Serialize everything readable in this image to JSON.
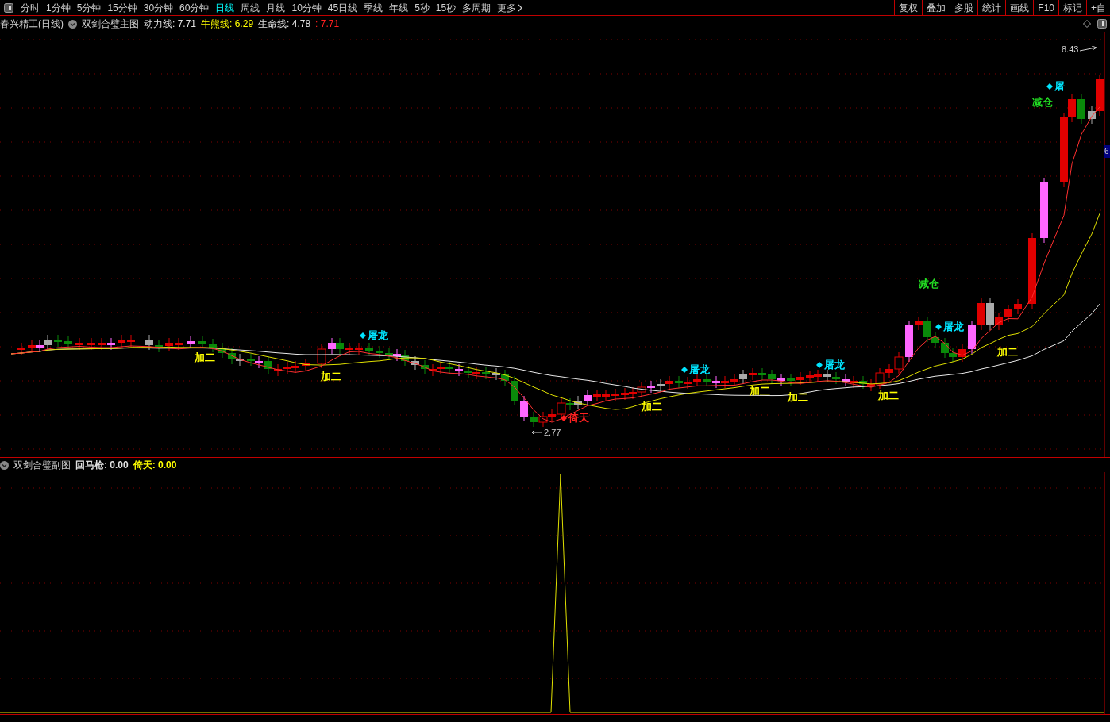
{
  "toolbar": {
    "tabs": [
      {
        "label": "分时",
        "selected": false
      },
      {
        "label": "1分钟",
        "selected": false
      },
      {
        "label": "5分钟",
        "selected": false
      },
      {
        "label": "15分钟",
        "selected": false
      },
      {
        "label": "30分钟",
        "selected": false
      },
      {
        "label": "60分钟",
        "selected": false
      },
      {
        "label": "日线",
        "selected": true
      },
      {
        "label": "周线",
        "selected": false
      },
      {
        "label": "月线",
        "selected": false
      },
      {
        "label": "10分钟",
        "selected": false
      },
      {
        "label": "45日线",
        "selected": false
      },
      {
        "label": "季线",
        "selected": false
      },
      {
        "label": "年线",
        "selected": false
      },
      {
        "label": "5秒",
        "selected": false
      },
      {
        "label": "15秒",
        "selected": false
      },
      {
        "label": "多周期",
        "selected": false
      }
    ],
    "more": "更多",
    "actions": [
      "复权",
      "叠加",
      "多股",
      "统计",
      "画线",
      "F10",
      "标记",
      "+自"
    ]
  },
  "main_legend": {
    "stock": "春兴精工(日线)",
    "indicator": "双剑合璧主图",
    "values": [
      {
        "text": "动力线: 7.71",
        "color": "#e0e0e0"
      },
      {
        "text": "牛熊线: 6.29",
        "color": "#ffff00"
      },
      {
        "text": "生命线: 4.78",
        "color": "#e0e0e0"
      },
      {
        "text": ": 7.71",
        "color": "#ff2020"
      }
    ]
  },
  "chart_labels": [
    {
      "kind": "plain",
      "text": "加二",
      "color": "#ffff00"
    },
    {
      "kind": "plain",
      "text": "加二",
      "color": "#ffff00"
    },
    {
      "kind": "signal",
      "text": "屠龙",
      "color": "#00e5ff"
    },
    {
      "kind": "signal",
      "text": "倚天",
      "color": "#ff2020"
    },
    {
      "kind": "plain",
      "text": "加二",
      "color": "#ffff00"
    },
    {
      "kind": "signal",
      "text": "屠龙",
      "color": "#00e5ff"
    },
    {
      "kind": "plain",
      "text": "加二",
      "color": "#ffff00"
    },
    {
      "kind": "plain",
      "text": "加二",
      "color": "#ffff00"
    },
    {
      "kind": "signal",
      "text": "屠龙",
      "color": "#00e5ff"
    },
    {
      "kind": "plain",
      "text": "加二",
      "color": "#ffff00"
    },
    {
      "kind": "plain",
      "text": "减仓",
      "color": "#22dd22"
    },
    {
      "kind": "signal",
      "text": "屠龙",
      "color": "#00e5ff"
    },
    {
      "kind": "plain",
      "text": "加二",
      "color": "#ffff00"
    },
    {
      "kind": "signal",
      "text": "屠",
      "color": "#00e5ff"
    },
    {
      "kind": "plain",
      "text": "减仓",
      "color": "#22dd22"
    }
  ],
  "price_marks": [
    {
      "kind": "high",
      "text": "8.43"
    },
    {
      "kind": "low",
      "text": "2.77"
    }
  ],
  "axis_label": "6",
  "sub_legend": {
    "indicator": "双剑合璧副图",
    "values": [
      {
        "text": "回马枪: 0.00",
        "color": "#e0e0e0"
      },
      {
        "text": "倚天: 0.00",
        "color": "#ffff00"
      }
    ]
  }
}
